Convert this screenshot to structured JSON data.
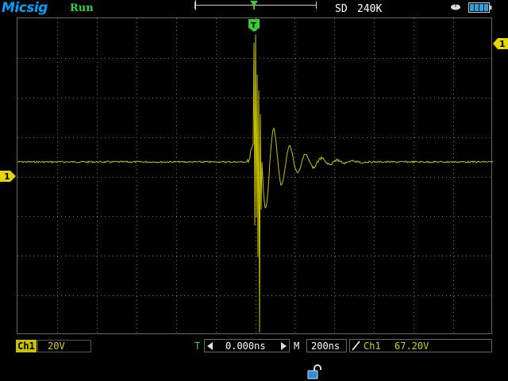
{
  "header": {
    "brand": "Micsig",
    "run_status": "Run",
    "acq_mode": "SD",
    "sample_depth": "240K"
  },
  "icons": {
    "mouse": "mouse-icon",
    "battery": "battery-icon",
    "lock": "unlock-icon",
    "edge": "rising-edge-icon"
  },
  "markers": {
    "channel_marker": "1",
    "trigger_level_marker": "1",
    "trigger_position_marker": "T"
  },
  "channel": {
    "tag": "Ch1",
    "scale": "20V",
    "color": "#c8c000"
  },
  "timebase": {
    "t_label": "T",
    "offset": "0.000ns",
    "m_label": "M",
    "scale": "200ns"
  },
  "trigger": {
    "source": "Ch1",
    "level": "67.20V"
  },
  "colors": {
    "brand": "#00a0ff",
    "run": "#34d33a",
    "trace": "#c8c000",
    "trigger_marker": "#33cc33"
  }
}
